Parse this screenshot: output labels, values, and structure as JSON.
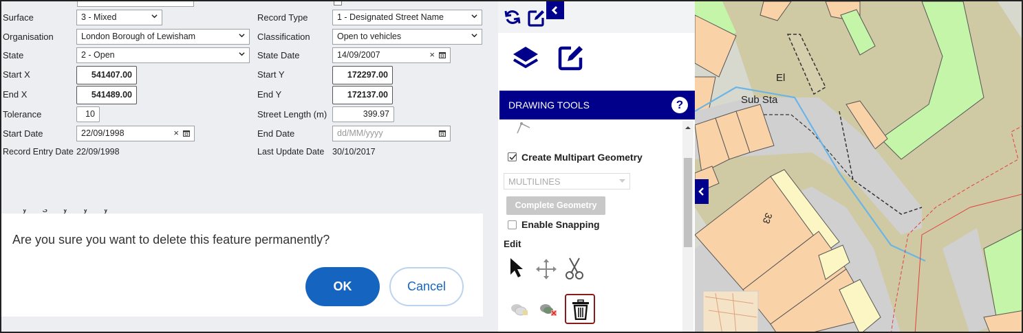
{
  "form": {
    "fields": {
      "surface": {
        "label": "Surface",
        "value": "3 - Mixed"
      },
      "record_type": {
        "label": "Record Type",
        "value": "1 - Designated Street Name"
      },
      "organisation": {
        "label": "Organisation",
        "value": "London Borough of Lewisham"
      },
      "classification": {
        "label": "Classification",
        "value": "Open to vehicles"
      },
      "state": {
        "label": "State",
        "value": "2 - Open"
      },
      "state_date": {
        "label": "State Date",
        "value": "14/09/2007"
      },
      "start_x": {
        "label": "Start X",
        "value": "541407.00"
      },
      "start_y": {
        "label": "Start Y",
        "value": "172297.00"
      },
      "end_x": {
        "label": "End X",
        "value": "541489.00"
      },
      "end_y": {
        "label": "End Y",
        "value": "172137.00"
      },
      "tolerance": {
        "label": "Tolerance",
        "value": "10"
      },
      "street_length": {
        "label": "Street Length (m)",
        "value": "399.97"
      },
      "start_date": {
        "label": "Start Date",
        "value": "22/09/1998"
      },
      "end_date": {
        "label": "End Date",
        "placeholder": "dd/MM/yyyy"
      },
      "record_entry_date": {
        "label": "Record Entry Date",
        "value": "22/09/1998"
      },
      "last_update_date": {
        "label": "Last Update Date",
        "value": "30/10/2017"
      }
    }
  },
  "dialog": {
    "message": "Are you sure you want to delete this feature permanently?",
    "ok_label": "OK",
    "cancel_label": "Cancel"
  },
  "panel": {
    "header": "DRAWING TOOLS",
    "help": "?",
    "multipart_label": "Create Multipart Geometry",
    "multipart_checked": true,
    "geometry_select": "MULTILINES",
    "complete_label": "Complete Geometry",
    "snapping_label": "Enable Snapping",
    "snapping_checked": false,
    "edit_label": "Edit"
  },
  "map": {
    "labels": {
      "el": "El",
      "substa": "Sub Sta",
      "house": "33"
    }
  },
  "colors": {
    "primary_blue": "#1565c0",
    "navy": "#00008b",
    "delete_border": "#8b1a1a",
    "parcel_orange": "#fad2a8",
    "parcel_yellow": "#fbf6c3",
    "parcel_green": "#c5f5a9",
    "road_gray": "#d0d0d0",
    "land_olive": "#cfc9a4",
    "line_blue": "#6ab4e6",
    "boundary_red": "#e04040"
  }
}
